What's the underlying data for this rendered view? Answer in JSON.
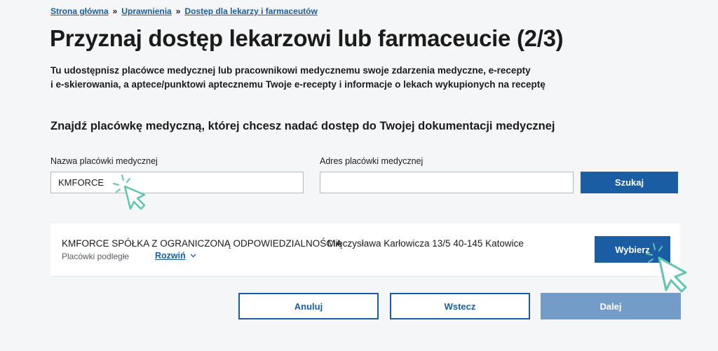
{
  "breadcrumb": {
    "items": [
      "Strona główna",
      "Uprawnienia",
      "Dostęp dla lekarzy i farmaceutów"
    ],
    "separator": "»"
  },
  "page": {
    "title": "Przyznaj dostęp lekarzowi lub farmaceucie (2/3)",
    "intro_line1": "Tu udostępnisz placówce medycznej lub pracownikowi medycznemu swoje zdarzenia medyczne, e-recepty",
    "intro_line2": "i e-skierowania, a aptece/punktowi aptecznemu Twoje e-recepty i informacje o lekach wykupionych na receptę"
  },
  "search": {
    "heading": "Znajdź placówkę medyczną, której chcesz nadać dostęp do Twojej dokumentacji medycznej",
    "name_label": "Nazwa placówki medycznej",
    "name_value": "KMFORCE",
    "address_label": "Adres placówki medycznej",
    "address_value": "",
    "search_button": "Szukaj"
  },
  "result": {
    "name": "KMFORCE SPÓŁKA Z OGRANICZONĄ ODPOWIEDZIALNOŚCIĄ",
    "sub_label": "Placówki podległe",
    "expand_label": "Rozwiń",
    "address": "Mieczysława Karłowicza 13/5 40-145 Katowice",
    "select_button": "Wybierz"
  },
  "actions": {
    "cancel": "Anuluj",
    "back": "Wstecz",
    "next": "Dalej"
  },
  "colors": {
    "primary": "#1a5da3",
    "disabled": "#739dc8",
    "cursor_accent": "#5fc4b0",
    "background": "#f5f6f7"
  },
  "icons": {
    "cursor": "pointer-cursor-icon",
    "chevron": "chevron-down-icon"
  }
}
